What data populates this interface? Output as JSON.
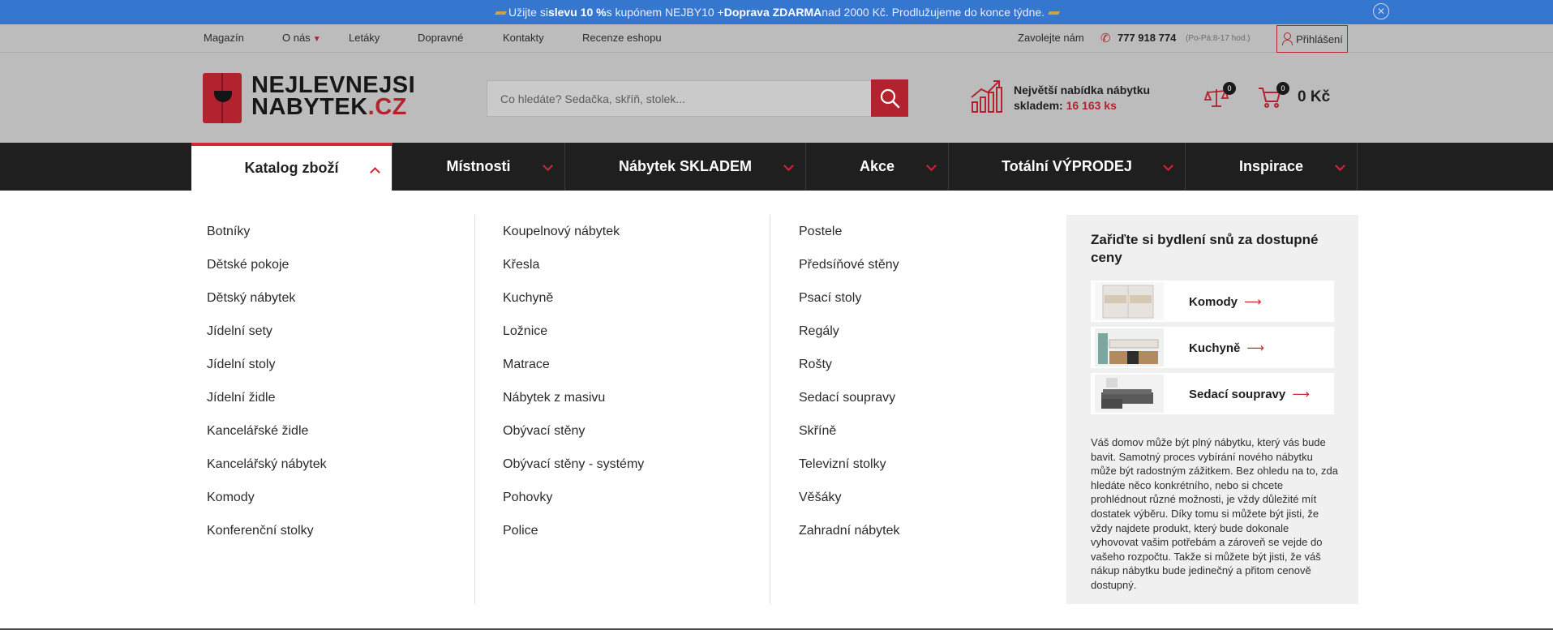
{
  "promo": {
    "t1": "Užijte si ",
    "b1": "slevu 10 %",
    "t2": " s kupónem NEJBY10 + ",
    "b2": "Doprava ZDARMA",
    "t3": " nad 2000 Kč. Prodlužujeme do konce týdne."
  },
  "topnav": {
    "items": [
      "Magazín",
      "O nás",
      "Letáky",
      "Dopravné",
      "Kontakty",
      "Recenze eshopu"
    ],
    "call_label": "Zavolejte nám",
    "phone": "777 918 774",
    "hours": "(Po-Pá:8-17 hod.)",
    "login": "Přihlášení"
  },
  "logo": {
    "line1": "NEJLEVNEJSI",
    "line2": "NABYTEK",
    "tld": ".CZ"
  },
  "search": {
    "placeholder": "Co hledáte? Sedačka, skříň, stolek..."
  },
  "stock": {
    "line1": "Největší nabídka nábytku",
    "line2": "skladem:",
    "count": "16 163 ks"
  },
  "compare": {
    "count": "0"
  },
  "cart": {
    "count": "0",
    "total": "0 Kč"
  },
  "mainnav": [
    "Katalog zboží",
    "Místnosti",
    "Nábytek SKLADEM",
    "Akce",
    "Totální VÝPRODEJ",
    "Inspirace"
  ],
  "menu": {
    "col1": [
      "Botníky",
      "Dětské pokoje",
      "Dětský nábytek",
      "Jídelní sety",
      "Jídelní stoly",
      "Jídelní židle",
      "Kancelářské židle",
      "Kancelářský nábytek",
      "Komody",
      "Konferenční stolky"
    ],
    "col2": [
      "Koupelnový nábytek",
      "Křesla",
      "Kuchyně",
      "Ložnice",
      "Matrace",
      "Nábytek z masivu",
      "Obývací stěny",
      "Obývací stěny - systémy",
      "Pohovky",
      "Police"
    ],
    "col3": [
      "Postele",
      "Předsíňové stěny",
      "Psací stoly",
      "Regály",
      "Rošty",
      "Sedací soupravy",
      "Skříně",
      "Televizní stolky",
      "Věšáky",
      "Zahradní nábytek"
    ]
  },
  "promo_box": {
    "title": "Zařiďte si bydlení snů za dostupné ceny",
    "cards": [
      "Komody",
      "Kuchyně",
      "Sedací soupravy"
    ],
    "description": "Váš domov může být plný nábytku, který vás bude bavit. Samotný proces vybírání nového nábytku může být radostným zážitkem. Bez ohledu na to, zda hledáte něco konkrétního, nebo si chcete prohlédnout různé možnosti, je vždy důležité mít dostatek výběru. Díky tomu si můžete být jisti, že vždy najdete produkt, který bude dokonale vyhovovat vašim potřebám a zároveň se vejde do vašeho rozpočtu. Takže si můžete být jisti, že váš nákup nábytku bude jedinečný a přitom cenově dostupný."
  },
  "colors": {
    "accent": "#b3232f",
    "promo_bg": "#3576cf",
    "nav_bg": "#1f1f1f"
  },
  "icons": [
    "close-icon",
    "phone-icon",
    "user-icon",
    "search-icon",
    "stock-chart-icon",
    "scales-icon",
    "cart-icon",
    "chevron-down-icon",
    "arrow-right-icon"
  ]
}
